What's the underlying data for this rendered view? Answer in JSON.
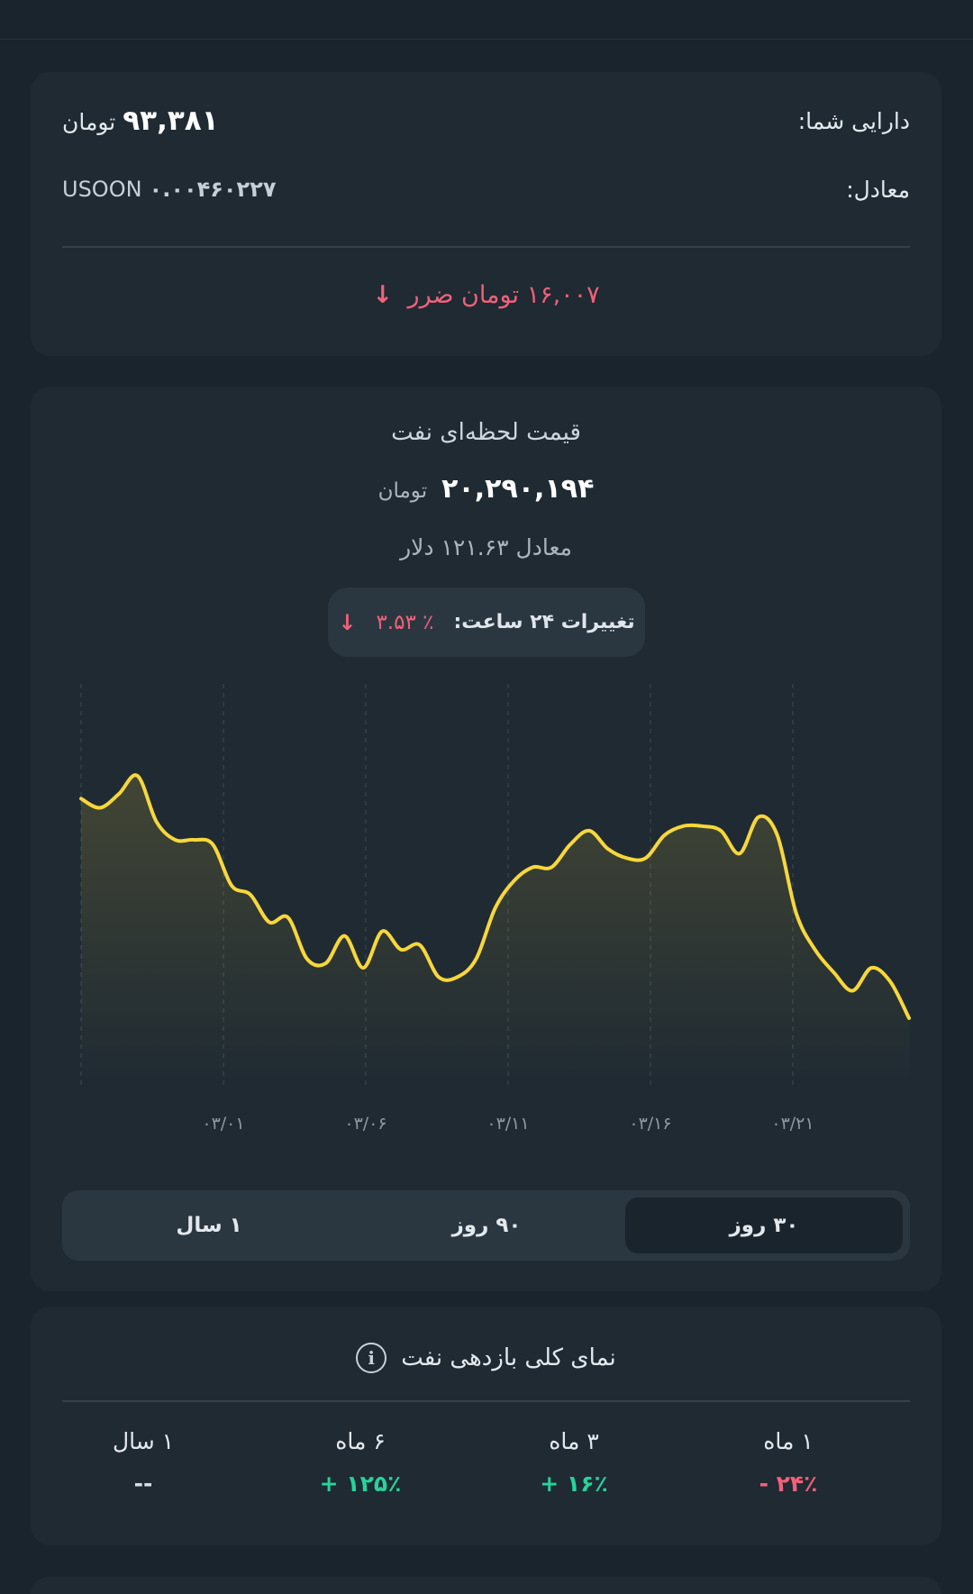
{
  "assets": {
    "label": "دارایی شما:",
    "amount": "۹۳,۳۸۱",
    "amount_unit": "تومان",
    "equiv_label": "معادل:",
    "equiv_value": "۰.۰۰۴۶۰۲۲۷",
    "equiv_unit": "USOON",
    "loss_text": "۱۶,۰۰۷ تومان ضرر",
    "loss_arrow": "↓"
  },
  "price": {
    "title": "قیمت لحظه‌ای نفت",
    "value": "۲۰,۲۹۰,۱۹۴",
    "unit": "تومان",
    "equiv": "معادل ۱۲۱.۶۳ دلار",
    "change_label": "تغییرات ۲۴ ساعت:",
    "change_value": "٪ ۳.۵۳",
    "change_arrow": "↓"
  },
  "chart_data": {
    "type": "area",
    "x_tick_labels": [
      "۰۳/۰۱",
      "۰۳/۰۶",
      "۰۳/۱۱",
      "۰۳/۱۶",
      "۰۳/۲۱"
    ],
    "series": [
      {
        "values": [
          62,
          60,
          63,
          67,
          57,
          53,
          53,
          52,
          43,
          41,
          35,
          36,
          27,
          26,
          32,
          25,
          33,
          29,
          30,
          23,
          23,
          27,
          38,
          44,
          47,
          47,
          52,
          55,
          51,
          49,
          49,
          54,
          56,
          56,
          55,
          50,
          58,
          54,
          37,
          29,
          24,
          20,
          25,
          22,
          14
        ]
      }
    ],
    "line_color": "#f7d73a",
    "grid": "vertical dashed",
    "legend": "none"
  },
  "range_tabs": [
    {
      "label": "۳۰ روز",
      "active": true
    },
    {
      "label": "۹۰ روز",
      "active": false
    },
    {
      "label": "۱ سال",
      "active": false
    }
  ],
  "performance": {
    "title": "نمای کلی بازدهی نفت",
    "info_glyph": "i",
    "items": [
      {
        "period": "۱ ماه",
        "value": "- ۲۴٪",
        "status": "negative"
      },
      {
        "period": "۳ ماه",
        "value": "+ ۱۶٪",
        "status": "positive"
      },
      {
        "period": "۶ ماه",
        "value": "+ ۱۲۵٪",
        "status": "positive"
      },
      {
        "period": "۱ سال",
        "value": "--",
        "status": "none"
      }
    ]
  },
  "colors": {
    "background": "#1a242d",
    "card": "#1f2a33",
    "negative": "#f0617a",
    "positive": "#27d39a",
    "chart_line": "#f7d73a"
  }
}
